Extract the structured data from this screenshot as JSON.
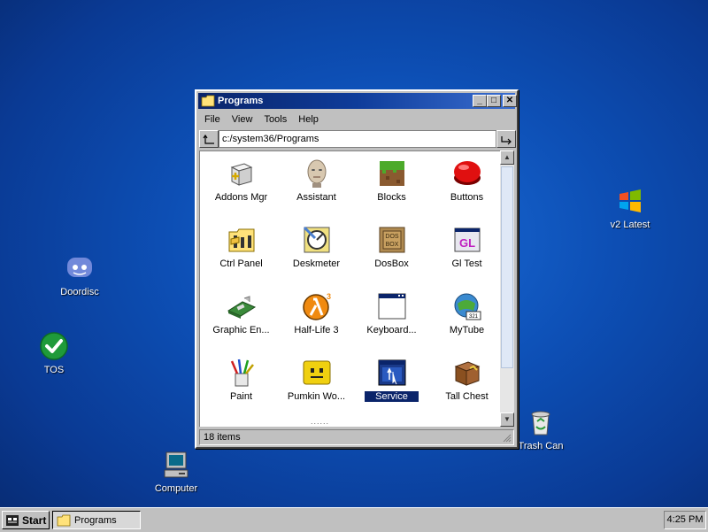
{
  "desktop": {
    "icons": [
      {
        "label": "v2 Latest"
      },
      {
        "label": "Doordisc"
      },
      {
        "label": "TOS"
      },
      {
        "label": "Computer"
      },
      {
        "label": "Trash Can"
      }
    ]
  },
  "window": {
    "title": "Programs",
    "controls": {
      "minimize": "_",
      "maximize": "□",
      "close": "✕"
    },
    "menu": [
      "File",
      "View",
      "Tools",
      "Help"
    ],
    "address": "c:/system36/Programs",
    "items": [
      {
        "label": "Addons Mgr"
      },
      {
        "label": "Assistant"
      },
      {
        "label": "Blocks"
      },
      {
        "label": "Buttons"
      },
      {
        "label": "Ctrl Panel"
      },
      {
        "label": "Deskmeter"
      },
      {
        "label": "DosBox"
      },
      {
        "label": "Gl Test"
      },
      {
        "label": "Graphic En..."
      },
      {
        "label": "Half-Life 3"
      },
      {
        "label": "Keyboard..."
      },
      {
        "label": "MyTube"
      },
      {
        "label": "Paint"
      },
      {
        "label": "Pumkin Wo..."
      },
      {
        "label": "Service"
      },
      {
        "label": "Tall Chest"
      }
    ],
    "selected_item": "Service",
    "more_indicator": "......",
    "status": "18 items"
  },
  "taskbar": {
    "start_label": "Start",
    "task_label": "Programs",
    "clock": "4:25 PM"
  },
  "colors": {
    "desktop": "#0d4fb5",
    "titlebar": "#0a246a",
    "selection": "#0a246a",
    "chrome": "#c0c0c0"
  }
}
